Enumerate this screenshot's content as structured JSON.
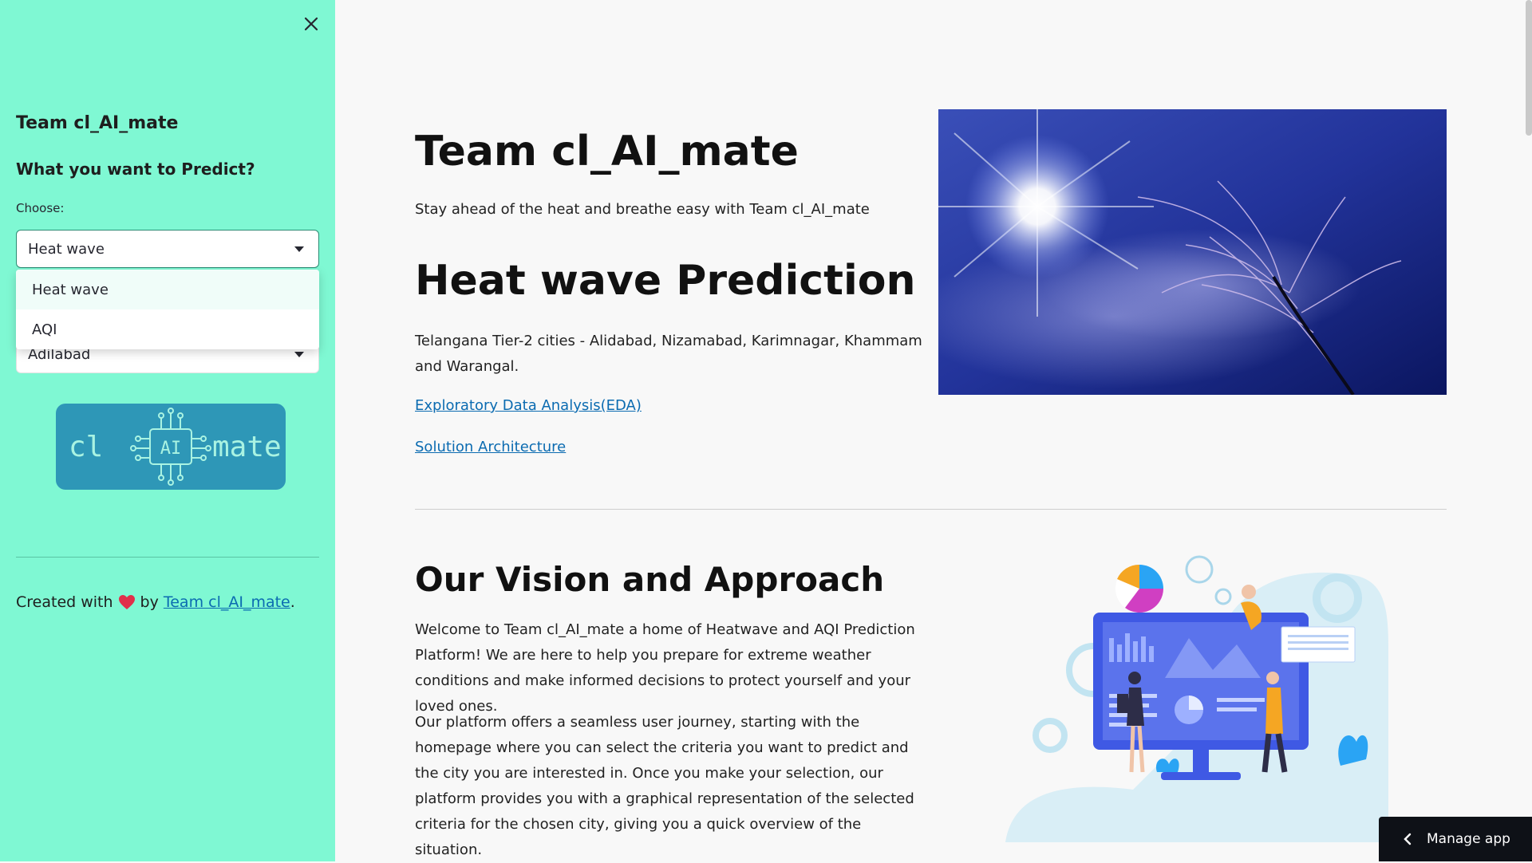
{
  "sidebar": {
    "title": "Team cl_AI_mate",
    "subtitle": "What you want to Predict?",
    "choose_label": "Choose:",
    "select_value": "Heat wave",
    "dropdown_options": [
      "Heat wave",
      "AQI"
    ],
    "city_value": "Adilabad",
    "logo": {
      "left": "cl",
      "center": "AI",
      "right": "mate"
    },
    "footer": {
      "prefix": "Created with",
      "by": "by",
      "link": "Team cl_AI_mate",
      "suffix": "."
    }
  },
  "main": {
    "title": "Team cl_AI_mate",
    "tagline": "Stay ahead of the heat and breathe easy with Team cl_AI_mate",
    "heading": "Heat wave Prediction",
    "cities_text": "Telangana Tier-2 cities - Alidabad, Nizamabad, Karimnagar, Khammam and Warangal.",
    "links": {
      "eda": "Exploratory Data Analysis(EDA)",
      "architecture": "Solution Architecture"
    },
    "vision": {
      "heading": "Our Vision and Approach",
      "para1": "Welcome to Team cl_AI_mate a home of Heatwave and AQI Prediction Platform! We are here to help you prepare for extreme weather conditions and make informed decisions to protect yourself and your loved ones.",
      "para2": "Our platform offers a seamless user journey, starting with the homepage where you can select the criteria you want to predict and the city you are interested in. Once you make your selection, our platform provides you with a graphical representation of the selected criteria for the chosen city, giving you a quick overview of the situation."
    }
  },
  "manage_app_label": "Manage app",
  "colors": {
    "sidebar_bg": "#7ff8d3",
    "link": "#0b6bb1",
    "logo_bg": "#2e97b7"
  }
}
